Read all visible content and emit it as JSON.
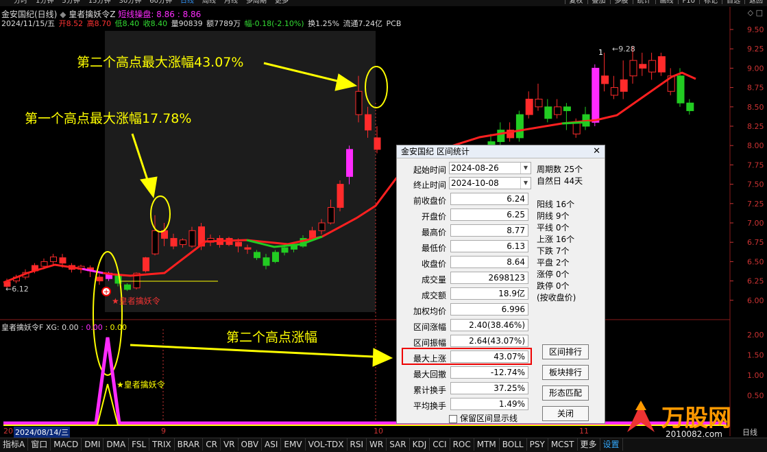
{
  "topnav": {
    "timeframes": [
      "分时",
      "1分钟",
      "5分钟",
      "15分钟",
      "30分钟",
      "60分钟",
      "日线",
      "周线",
      "月线",
      "多周期",
      "更多"
    ],
    "active": "日线",
    "right": [
      "复权",
      "叠加",
      "多股",
      "统计",
      "画线",
      "F10",
      "标记",
      "自选",
      "返回"
    ]
  },
  "header": {
    "stock": "金安国纪(日线)",
    "indicator": "皇者擒妖令Z",
    "short_label": "短线操盘: 8.86 : 8.86",
    "date": "2024/11/15/五",
    "open": "开8.52",
    "high": "高8.70",
    "low": "低8.40",
    "close": "收8.40",
    "volume": "量90839",
    "amount": "额7789万",
    "change": "幅-0.18(-2.10%)",
    "turnover": "换1.25%",
    "float": "流通7.24亿",
    "pcb": "PCB"
  },
  "annotations": {
    "high2": "第二个高点最大涨幅43.07%",
    "high1": "第一个高点最大涨幅17.78%",
    "high2_rise": "第二个高点涨幅",
    "signal_main": "皇者擒妖令",
    "signal_sub": "皇者擒妖令",
    "low_label": "6.12",
    "high_label": "9.28",
    "mark_1": "1"
  },
  "price_axis": [
    "9.50",
    "9.25",
    "9.00",
    "8.75",
    "8.50",
    "8.25",
    "8.00",
    "7.75",
    "7.50",
    "7.25",
    "7.00",
    "6.75",
    "6.50",
    "6.25",
    "6.00"
  ],
  "sub_axis": [
    "2.00",
    "1.50",
    "1.00",
    "0.50"
  ],
  "subchart": {
    "title": "皇者擒妖令F",
    "xg_label": "XG: 0.00",
    "v1": "0.00",
    "v2": "0.00"
  },
  "datebar": {
    "selected": "2024/08/14/三",
    "ticks": [
      "20",
      "9",
      "10",
      "11"
    ],
    "right": "日线"
  },
  "dialog": {
    "title": "金安国纪 区间统计",
    "start_label": "起始时间",
    "start_value": "2024-08-26",
    "end_label": "终止时间",
    "end_value": "2024-10-08",
    "rows": [
      {
        "label": "前收盘价",
        "value": "6.24"
      },
      {
        "label": "开盘价",
        "value": "6.25"
      },
      {
        "label": "最高价",
        "value": "8.77"
      },
      {
        "label": "最低价",
        "value": "6.13"
      },
      {
        "label": "收盘价",
        "value": "8.64"
      },
      {
        "label": "成交量",
        "value": "2698123"
      },
      {
        "label": "成交额",
        "value": "18.9亿"
      },
      {
        "label": "加权均价",
        "value": "6.996"
      },
      {
        "label": "区间涨幅",
        "value": "2.40(38.46%)"
      },
      {
        "label": "区间振幅",
        "value": "2.64(43.07%)"
      },
      {
        "label": "最大上涨",
        "value": "43.07%"
      },
      {
        "label": "最大回撤",
        "value": "-12.74%"
      },
      {
        "label": "累计换手",
        "value": "37.25%"
      },
      {
        "label": "平均换手",
        "value": "1.49%"
      }
    ],
    "stats_a": [
      "周期数 25个",
      "自然日 44天"
    ],
    "stats_b": [
      "阳线 16个",
      "阴线 9个",
      "平线 0个",
      "上涨 16个",
      "下跌 7个",
      "平盘 2个",
      "涨停 0个",
      "跌停 0个",
      "(按收盘价)"
    ],
    "buttons": [
      "区间排行",
      "板块排行",
      "形态匹配",
      "关闭"
    ],
    "checkbox": "保留区间显示线"
  },
  "bottom_tabs": [
    "指标A",
    "窗口",
    "MACD",
    "DMI",
    "DMA",
    "FSL",
    "TRIX",
    "BRAR",
    "CR",
    "VR",
    "OBV",
    "ASI",
    "EMV",
    "VOL-TDX",
    "RSI",
    "WR",
    "SAR",
    "KDJ",
    "CCI",
    "ROC",
    "MTM",
    "BOLL",
    "PSY",
    "MCST",
    "更多",
    "设置"
  ],
  "bottom_selected": "设置",
  "logo": {
    "text": "万股网",
    "url": "2010082.com"
  },
  "colors": {
    "up": "#ff2b2b",
    "down": "#22cc22",
    "magenta": "#ff2bff",
    "annotation": "#ffff00",
    "ma": "#ff2020"
  }
}
